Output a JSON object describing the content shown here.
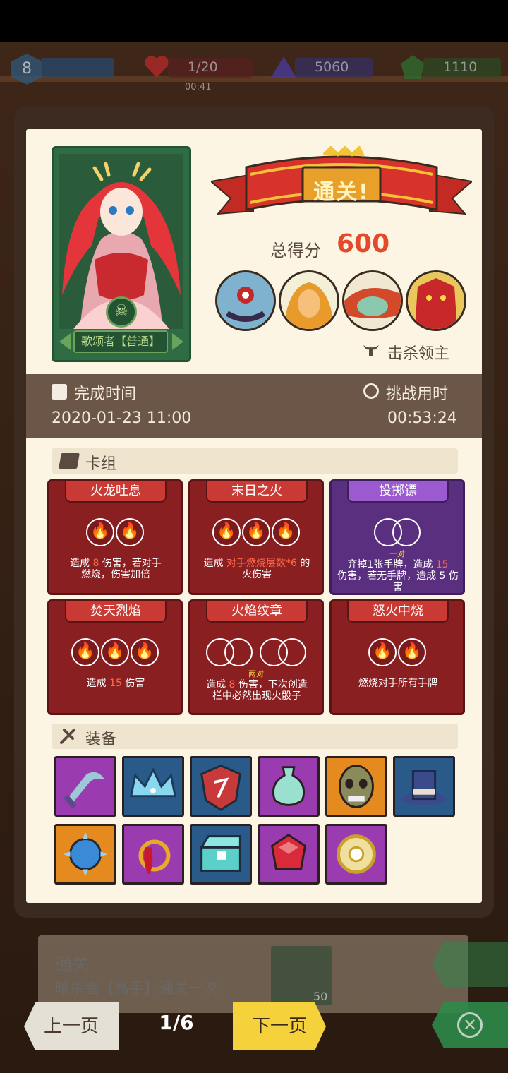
{
  "hud": {
    "level": "8",
    "hp": "1/20",
    "gems": "5060",
    "green": "1110",
    "timer": "00:41"
  },
  "result": {
    "banner_title": "通关!",
    "score_label": "总得分",
    "score_value": "600",
    "kill_boss_label": "击杀领主"
  },
  "hero": {
    "name": "歌颂者【普通】"
  },
  "stats": {
    "finish_time_label": "完成时间",
    "finish_time_value": "2020-01-23 11:00",
    "challenge_time_label": "挑战用时",
    "challenge_time_value": "00:53:24"
  },
  "deck": {
    "title": "卡组",
    "cards": [
      {
        "name": "火龙吐息",
        "color": "red",
        "dice": 2,
        "desc_pre": "造成 ",
        "desc_num": "8",
        "desc_mid": " 伤害，若对手",
        "desc_post": "燃烧，伤害加倍",
        "pair": ""
      },
      {
        "name": "末日之火",
        "color": "red",
        "dice": 3,
        "desc_pre": "造成 ",
        "desc_num": "对手燃烧层数*6",
        "desc_mid": " 的",
        "desc_post": "火伤害",
        "pair": ""
      },
      {
        "name": "投掷镖",
        "color": "purple",
        "dice": 0,
        "desc_pre": "弃掉1张手牌，造成 ",
        "desc_num": "15",
        "desc_mid": "",
        "desc_post": "伤害，若无手牌，造成 5 伤害",
        "pair": "一对"
      },
      {
        "name": "焚天烈焰",
        "color": "red",
        "dice": 3,
        "desc_pre": "造成 ",
        "desc_num": "15",
        "desc_mid": " 伤害",
        "desc_post": "",
        "pair": ""
      },
      {
        "name": "火焰纹章",
        "color": "red",
        "dice": 0,
        "desc_pre": "造成 ",
        "desc_num": "8",
        "desc_mid": " 伤害，下次创造",
        "desc_post": "栏中必然出现火骰子",
        "pair": "两对"
      },
      {
        "name": "怒火中烧",
        "color": "red",
        "dice": 2,
        "desc_pre": "",
        "desc_num": "",
        "desc_mid": "燃烧对手所有手牌",
        "desc_post": "",
        "pair": ""
      }
    ]
  },
  "equipment": {
    "title": "装备",
    "items": [
      {
        "icon": "scythe-icon",
        "color": "purple"
      },
      {
        "icon": "crown-icon",
        "color": "blue"
      },
      {
        "icon": "shield-icon",
        "color": "blue"
      },
      {
        "icon": "vase-icon",
        "color": "purple"
      },
      {
        "icon": "mask-icon",
        "color": "orange"
      },
      {
        "icon": "top-hat-icon",
        "color": "blue"
      },
      {
        "icon": "spiked-ball-icon",
        "color": "orange"
      },
      {
        "icon": "ring-icon",
        "color": "purple"
      },
      {
        "icon": "chest-icon",
        "color": "blue"
      },
      {
        "icon": "gem-icon",
        "color": "purple"
      },
      {
        "icon": "medallion-icon",
        "color": "purple"
      }
    ]
  },
  "background_list": {
    "title": "通关",
    "subtitle": "暗杀者【高手】通关一次",
    "reward": "50"
  },
  "nav": {
    "prev": "上一页",
    "page": "1/6",
    "next": "下一页"
  }
}
